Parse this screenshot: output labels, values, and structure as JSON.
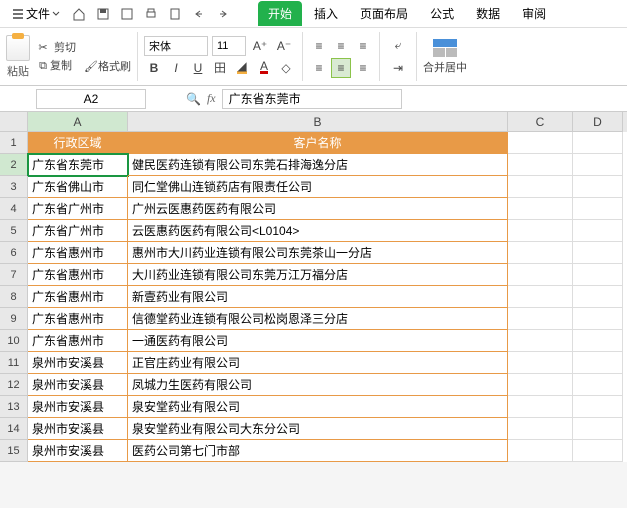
{
  "menubar": {
    "file_label": "文件",
    "tabs": [
      "开始",
      "插入",
      "页面布局",
      "公式",
      "数据",
      "审阅"
    ]
  },
  "ribbon": {
    "paste": "粘贴",
    "cut": "剪切",
    "copy": "复制",
    "format_painter": "格式刷",
    "font_name": "宋体",
    "font_size": "11",
    "increase_font": "A⁺",
    "decrease_font": "A⁻",
    "bold": "B",
    "italic": "I",
    "underline": "U",
    "merge_label": "合并居中"
  },
  "formula_bar": {
    "cell_ref": "A2",
    "fx": "fx",
    "value": "广东省东莞市"
  },
  "columns": [
    "A",
    "B",
    "C",
    "D"
  ],
  "header_row": {
    "colA": "行政区域",
    "colB": "客户名称"
  },
  "data_rows": [
    {
      "n": 2,
      "a": "广东省东莞市",
      "b": "健民医药连锁有限公司东莞石排海逸分店"
    },
    {
      "n": 3,
      "a": "广东省佛山市",
      "b": "同仁堂佛山连锁药店有限责任公司"
    },
    {
      "n": 4,
      "a": "广东省广州市",
      "b": "广州云医惠药医药有限公司"
    },
    {
      "n": 5,
      "a": "广东省广州市",
      "b": "云医惠药医药有限公司<L0104>"
    },
    {
      "n": 6,
      "a": "广东省惠州市",
      "b": "惠州市大川药业连锁有限公司东莞茶山一分店"
    },
    {
      "n": 7,
      "a": "广东省惠州市",
      "b": "大川药业连锁有限公司东莞万江万福分店"
    },
    {
      "n": 8,
      "a": "广东省惠州市",
      "b": "新壹药业有限公司"
    },
    {
      "n": 9,
      "a": "广东省惠州市",
      "b": "信德堂药业连锁有限公司松岗恩泽三分店"
    },
    {
      "n": 10,
      "a": "广东省惠州市",
      "b": "一通医药有限公司"
    },
    {
      "n": 11,
      "a": "泉州市安溪县",
      "b": "正官庄药业有限公司"
    },
    {
      "n": 12,
      "a": "泉州市安溪县",
      "b": "凤城力生医药有限公司"
    },
    {
      "n": 13,
      "a": "泉州市安溪县",
      "b": "泉安堂药业有限公司"
    },
    {
      "n": 14,
      "a": "泉州市安溪县",
      "b": "泉安堂药业有限公司大东分公司"
    },
    {
      "n": 15,
      "a": "泉州市安溪县",
      "b": "医药公司第七门市部"
    }
  ],
  "active_cell": "A2"
}
